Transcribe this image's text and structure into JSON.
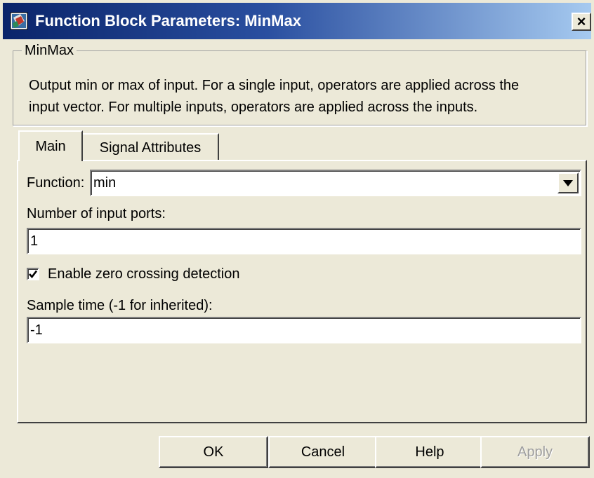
{
  "window": {
    "title": "Function Block Parameters: MinMax",
    "app_icon": "simulink-block-icon",
    "close_label": "×",
    "title_bar_color": "#0a246a"
  },
  "description": {
    "group_title": "MinMax",
    "text_line1": "Output min or max of input.  For a single input, operators are applied across the",
    "text_line2": "input vector.  For multiple inputs, operators are applied across the inputs."
  },
  "tabs": [
    {
      "label": "Main",
      "selected": true
    },
    {
      "label": "Signal Attributes",
      "selected": false
    }
  ],
  "main": {
    "function_label": "Function:",
    "function_value": "min",
    "ports_label": "Number of input ports:",
    "ports_value": "1",
    "zero_crossing_label": "Enable zero crossing detection",
    "zero_crossing_checked": true,
    "sample_time_label": "Sample time (-1 for inherited):",
    "sample_time_value": "-1"
  },
  "buttons": {
    "ok": "OK",
    "cancel": "Cancel",
    "help": "Help",
    "apply": "Apply",
    "apply_enabled": false
  }
}
